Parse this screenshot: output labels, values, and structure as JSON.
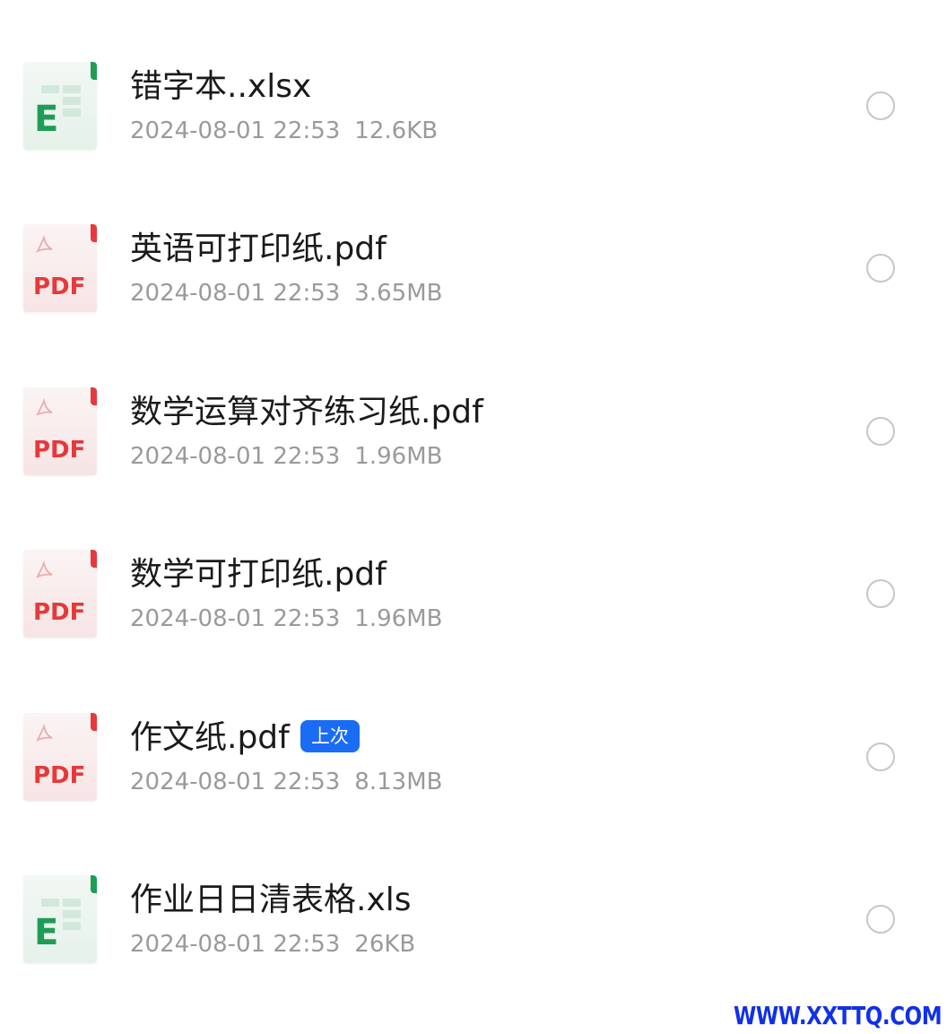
{
  "files": [
    {
      "name": "错字本..xlsx",
      "type": "excel",
      "date": "2024-08-01 22:53",
      "size": "12.6KB",
      "badge": ""
    },
    {
      "name": "英语可打印纸.pdf",
      "type": "pdf",
      "date": "2024-08-01 22:53",
      "size": "3.65MB",
      "badge": ""
    },
    {
      "name": "数学运算对齐练习纸.pdf",
      "type": "pdf",
      "date": "2024-08-01 22:53",
      "size": "1.96MB",
      "badge": ""
    },
    {
      "name": "数学可打印纸.pdf",
      "type": "pdf",
      "date": "2024-08-01 22:53",
      "size": "1.96MB",
      "badge": ""
    },
    {
      "name": "作文纸.pdf",
      "type": "pdf",
      "date": "2024-08-01 22:53",
      "size": "8.13MB",
      "badge": "上次"
    },
    {
      "name": "作业日日清表格.xls",
      "type": "excel",
      "date": "2024-08-01 22:53",
      "size": "26KB",
      "badge": ""
    }
  ],
  "icons": {
    "pdf_label": "PDF",
    "excel_label": "E",
    "pdf_color": "#e5393b",
    "excel_color": "#1f9d55"
  },
  "badge_color": "#1a6cf5",
  "watermark": "WWW.XXTTQ.COM"
}
